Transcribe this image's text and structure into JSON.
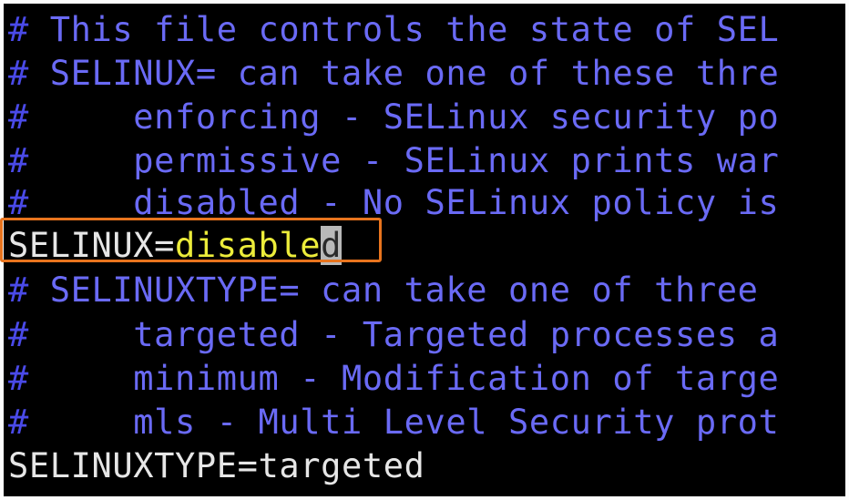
{
  "editor": {
    "lines": [
      {
        "hash": "#",
        "text": " This file controls the state of SEL"
      },
      {
        "hash": "#",
        "text": " SELINUX= can take one of these thre"
      },
      {
        "hash": "#",
        "text": "     enforcing - SELinux security po"
      },
      {
        "hash": "#",
        "text": "     permissive - SELinux prints war"
      },
      {
        "hash": "#",
        "text": "     disabled - No SELinux policy is"
      },
      {
        "key": "SELINUX=",
        "value": "disable",
        "cursor_char": "d"
      },
      {
        "hash": "#",
        "text": " SELINUXTYPE= can take one of three"
      },
      {
        "hash": "#",
        "text": "     targeted - Targeted processes a"
      },
      {
        "hash": "#",
        "text": "     minimum - Modification of targe"
      },
      {
        "hash": "#",
        "text": "     mls - Multi Level Security prot"
      },
      {
        "key": "SELINUXTYPE=targeted"
      }
    ]
  },
  "colors": {
    "background": "#000000",
    "comment": "#6a6af5",
    "plain_text": "#e6e6e6",
    "value_text": "#ecec3a",
    "cursor": "#b8b8b8",
    "highlight_border": "#e8741e"
  }
}
